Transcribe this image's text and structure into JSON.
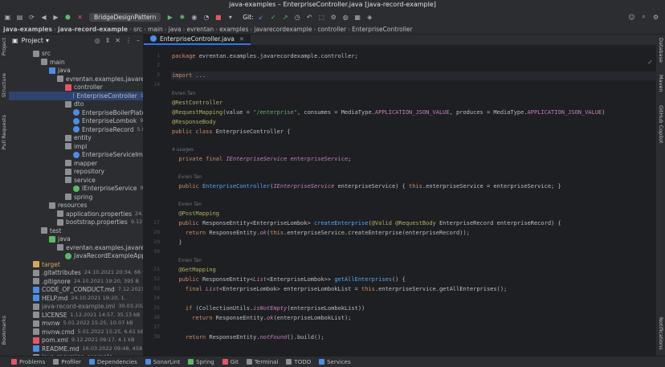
{
  "window": {
    "title": "java-examples – EnterpriseController.java [java-record-example]"
  },
  "toolbar": {
    "run_config": "BridgeDesignPattern",
    "git_label": "Git:"
  },
  "breadcrumb": [
    "java-examples",
    "java-record-example",
    "src",
    "main",
    "java",
    "evrentan",
    "examples",
    "javarecordexample",
    "controller",
    "EnterpriseController"
  ],
  "left_tabs": [
    "Project",
    "Structure",
    "Pull Requests",
    "Bookmarks"
  ],
  "right_tabs": [
    "Database",
    "Maven",
    "GitHub Copilot",
    "Notifications"
  ],
  "project": {
    "title": "Project",
    "tree": [
      {
        "label": "src",
        "meta": "",
        "icon": "folder",
        "color": "#8c8f94"
      },
      {
        "label": "main",
        "meta": "",
        "icon": "folder",
        "color": "#8c8f94"
      },
      {
        "label": "java",
        "meta": "",
        "icon": "folder",
        "color": "#4e8de6"
      },
      {
        "label": "evrentan.examples.javarecord",
        "meta": "",
        "icon": "package",
        "color": "#8c8f94"
      },
      {
        "label": "controller",
        "meta": "",
        "icon": "package",
        "color": "#e55765"
      },
      {
        "label": "EnterpriseController",
        "meta": "9",
        "icon": "class",
        "color": "#4e8de6"
      },
      {
        "label": "dto",
        "meta": "",
        "icon": "package",
        "color": "#8c8f94"
      },
      {
        "label": "EnterpriseBoilerPlate",
        "meta": "",
        "icon": "class",
        "color": "#4e8de6"
      },
      {
        "label": "EnterpriseLombok",
        "meta": "9.1",
        "icon": "class",
        "color": "#4e8de6"
      },
      {
        "label": "EnterpriseRecord",
        "meta": "5.01",
        "icon": "record",
        "color": "#4e8de6"
      },
      {
        "label": "entity",
        "meta": "",
        "icon": "package",
        "color": "#8c8f94"
      },
      {
        "label": "impl",
        "meta": "",
        "icon": "package",
        "color": "#8c8f94"
      },
      {
        "label": "EnterpriseServiceImpl",
        "meta": "",
        "icon": "class",
        "color": "#4e8de6"
      },
      {
        "label": "mapper",
        "meta": "",
        "icon": "package",
        "color": "#8c8f94"
      },
      {
        "label": "repository",
        "meta": "",
        "icon": "package",
        "color": "#8c8f94"
      },
      {
        "label": "service",
        "meta": "",
        "icon": "package",
        "color": "#8c8f94"
      },
      {
        "label": "IEnterpriseService",
        "meta": "9.1",
        "icon": "interface",
        "color": "#5fb865"
      },
      {
        "label": "spring",
        "meta": "",
        "icon": "package",
        "color": "#8c8f94"
      },
      {
        "label": "resources",
        "meta": "",
        "icon": "folder",
        "color": "#8c8f94"
      },
      {
        "label": "application.properties",
        "meta": "24.10.",
        "icon": "file",
        "color": "#8c8f94"
      },
      {
        "label": "bootstrap.properties",
        "meta": "9.12.20",
        "icon": "file",
        "color": "#8c8f94"
      },
      {
        "label": "test",
        "meta": "",
        "icon": "folder",
        "color": "#8c8f94"
      },
      {
        "label": "java",
        "meta": "",
        "icon": "folder",
        "color": "#5fb865"
      },
      {
        "label": "evrentan.examples.javarecord",
        "meta": "",
        "icon": "package",
        "color": "#8c8f94"
      },
      {
        "label": "JavaRecordExampleAppl",
        "meta": "",
        "icon": "class",
        "color": "#5fb865"
      },
      {
        "label": "target",
        "meta": "",
        "icon": "folder",
        "color": "#d6a75b"
      },
      {
        "label": ".gitattributes",
        "meta": "24.10.2021 20:34, 66 B",
        "icon": "file",
        "color": "#8c8f94"
      },
      {
        "label": ".gitignore",
        "meta": "24.10.2021 19:20, 395 B",
        "icon": "file",
        "color": "#8c8f94"
      },
      {
        "label": "CODE_OF_CONDUCT.md",
        "meta": "7.12.2021 1",
        "icon": "file",
        "color": "#4e8de6"
      },
      {
        "label": "HELP.md",
        "meta": "24.10.2021 19:20, 1.",
        "icon": "file",
        "color": "#4e8de6"
      },
      {
        "label": "java-record-example.iml",
        "meta": "30.03.2023",
        "icon": "file",
        "color": "#8c8f94"
      },
      {
        "label": "LICENSE",
        "meta": "1.12.2021 14:57, 35.13 kB",
        "icon": "file",
        "color": "#8c8f94"
      },
      {
        "label": "mvnw",
        "meta": "5.01.2022 15:25, 10.07 kB",
        "icon": "file",
        "color": "#8c8f94"
      },
      {
        "label": "mvnw.cmd",
        "meta": "5.01.2022 15:25, 6.61 kB",
        "icon": "file",
        "color": "#8c8f94"
      },
      {
        "label": "pom.xml",
        "meta": "9.12.2021 09:17, 4.1 kB",
        "icon": "file",
        "color": "#e55765"
      },
      {
        "label": "README.md",
        "meta": "16.03.2022 09:48, 458 B",
        "icon": "file",
        "color": "#4e8de6"
      },
      {
        "label": "java-recursion-example",
        "meta": "",
        "icon": "folder",
        "color": "#8c8f94"
      }
    ]
  },
  "editor": {
    "tab": "EnterpriseController.java",
    "author_hint": "Evren Tan",
    "usages_hint": "4 usages",
    "lines": [
      {
        "n": "1",
        "segs": [
          [
            "kw",
            "package "
          ],
          [
            "ty",
            "evrentan.examples.javarecordexample.controller;"
          ]
        ]
      },
      {
        "n": "2",
        "segs": []
      },
      {
        "n": "3",
        "segs": [
          [
            "kw",
            "import "
          ],
          [
            "ty",
            "..."
          ]
        ]
      },
      {
        "n": "14",
        "segs": []
      },
      {
        "hint": "Evren Tan"
      },
      {
        "n": "",
        "segs": [
          [
            "an",
            "@RestController"
          ]
        ]
      },
      {
        "n": "",
        "segs": [
          [
            "an",
            "@RequestMapping"
          ],
          [
            "ty",
            "(value = "
          ],
          [
            "st",
            "\"/enterprise\""
          ],
          [
            "ty",
            ", consumes = MediaType."
          ],
          [
            "fd",
            "APPLICATION_JSON_VALUE"
          ],
          [
            "ty",
            ", produces = MediaType."
          ],
          [
            "fd",
            "APPLICATION_JSON_VALUE"
          ],
          [
            "ty",
            ")"
          ]
        ]
      },
      {
        "n": "",
        "segs": [
          [
            "an",
            "@ResponseBody"
          ]
        ]
      },
      {
        "n": "",
        "segs": [
          [
            "kw",
            "public class "
          ],
          [
            "ty",
            "EnterpriseController {"
          ]
        ]
      },
      {
        "n": "",
        "segs": []
      },
      {
        "hint": "4 usages"
      },
      {
        "n": "",
        "segs": [
          [
            "kw",
            "  private final "
          ],
          [
            "it",
            "IEnterpriseService"
          ],
          [
            "fd",
            " enterpriseService"
          ],
          [
            "ty",
            ";"
          ]
        ]
      },
      {
        "n": "",
        "segs": []
      },
      {
        "hint": "Evren Tan"
      },
      {
        "n": "",
        "segs": [
          [
            "kw",
            "  public "
          ],
          [
            "fn",
            "EnterpriseController"
          ],
          [
            "ty",
            "("
          ],
          [
            "it",
            "IEnterpriseService"
          ],
          [
            "ty",
            " enterpriseService) { "
          ],
          [
            "kw",
            "this"
          ],
          [
            "ty",
            ".enterpriseService = enterpriseService; }"
          ]
        ]
      },
      {
        "n": "",
        "segs": []
      },
      {
        "hint": "Evren Tan"
      },
      {
        "n": "",
        "segs": [
          [
            "an",
            "  @PostMapping"
          ]
        ]
      },
      {
        "n": "27",
        "segs": [
          [
            "kw",
            "  public "
          ],
          [
            "ty",
            "ResponseEntity<EnterpriseLombok> "
          ],
          [
            "fn",
            "createEnterprise"
          ],
          [
            "ty",
            "("
          ],
          [
            "an",
            "@Valid @RequestBody "
          ],
          [
            "ty",
            "EnterpriseRecord enterpriseRecord) {"
          ]
        ]
      },
      {
        "n": "28",
        "segs": [
          [
            "kw",
            "    return "
          ],
          [
            "ty",
            "ResponseEntity."
          ],
          [
            "it",
            "ok"
          ],
          [
            "ty",
            "("
          ],
          [
            "kw",
            "this"
          ],
          [
            "ty",
            ".enterpriseService.createEnterprise(enterpriseRecord));"
          ]
        ]
      },
      {
        "n": "29",
        "segs": [
          [
            "ty",
            "  }"
          ]
        ]
      },
      {
        "n": "30",
        "segs": []
      },
      {
        "hint": "Evren Tan"
      },
      {
        "n": "31",
        "segs": [
          [
            "an",
            "  @GetMapping"
          ]
        ]
      },
      {
        "n": "32",
        "segs": [
          [
            "kw",
            "  public "
          ],
          [
            "ty",
            "ResponseEntity<"
          ],
          [
            "it",
            "List"
          ],
          [
            "ty",
            "<EnterpriseLombok>> "
          ],
          [
            "fn",
            "getAllEnterprises"
          ],
          [
            "ty",
            "() {"
          ]
        ]
      },
      {
        "n": "33",
        "segs": [
          [
            "kw",
            "    final "
          ],
          [
            "it",
            "List"
          ],
          [
            "ty",
            "<EnterpriseLombok> enterpriseLombokList = "
          ],
          [
            "kw",
            "this"
          ],
          [
            "ty",
            ".enterpriseService.getAllEnterprises();"
          ]
        ]
      },
      {
        "n": "34",
        "segs": []
      },
      {
        "n": "35",
        "segs": [
          [
            "kw",
            "    if "
          ],
          [
            "ty",
            "(CollectionUtils."
          ],
          [
            "it",
            "isNotEmpty"
          ],
          [
            "ty",
            "(enterpriseLombokList))"
          ]
        ]
      },
      {
        "n": "36",
        "segs": [
          [
            "kw",
            "      return "
          ],
          [
            "ty",
            "ResponseEntity."
          ],
          [
            "it",
            "ok"
          ],
          [
            "ty",
            "(enterpriseLombokList);"
          ]
        ]
      },
      {
        "n": "37",
        "segs": []
      },
      {
        "n": "38",
        "segs": [
          [
            "kw",
            "    return "
          ],
          [
            "ty",
            "ResponseEntity."
          ],
          [
            "it",
            "notFound"
          ],
          [
            "ty",
            "().build();"
          ]
        ]
      }
    ]
  },
  "status_bar": [
    "Problems",
    "Profiler",
    "Dependencies",
    "SonarLint",
    "Spring",
    "Git",
    "Terminal",
    "TODO",
    "Services"
  ]
}
